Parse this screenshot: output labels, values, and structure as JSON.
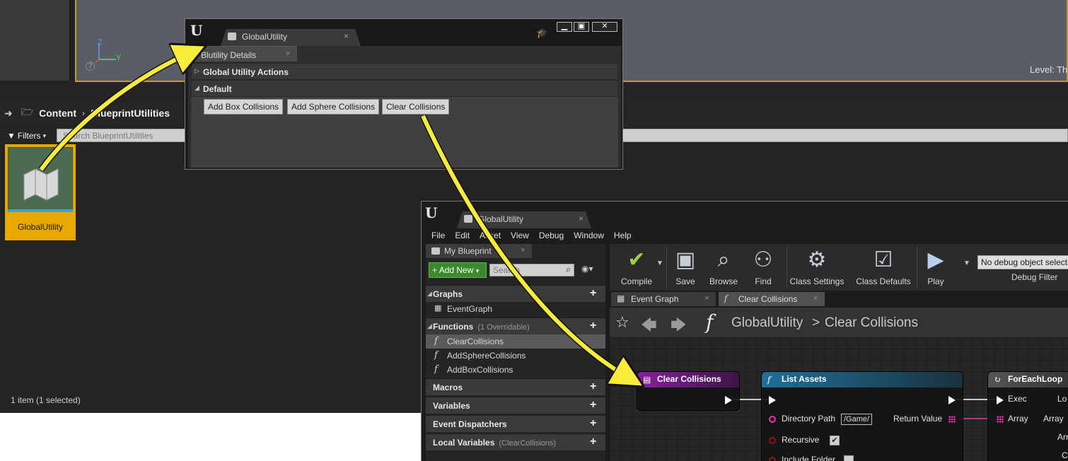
{
  "viewport": {
    "axis_z": "Z",
    "axis_y": "Y",
    "help": "?",
    "level_label": "Level:  Th"
  },
  "content_browser": {
    "path": [
      "Content",
      "BlueprintUtilities"
    ],
    "path_separator": "›",
    "filters_label": "Filters",
    "search_placeholder": "Search BlueprintUtilities",
    "asset_name": "GlobalUtility",
    "item_count": "1 item (1 selected)"
  },
  "utility_window": {
    "logo": "U",
    "tab_label": "GlobalUtility",
    "tab_close": "×",
    "subtab_label": "Blutility Details",
    "subtab_close": "×",
    "sections": [
      "Global Utility Actions",
      "Default"
    ],
    "buttons": [
      "Add Box Collisions",
      "Add Sphere Collisions",
      "Clear Collisions"
    ],
    "window_controls": {
      "minimize": "▁",
      "maximize": "▣",
      "close": "✕"
    }
  },
  "blueprint_editor": {
    "logo": "U",
    "tab_label": "GlobalUtility",
    "tab_close": "×",
    "menu": [
      "File",
      "Edit",
      "Asset",
      "View",
      "Debug",
      "Window",
      "Help"
    ],
    "my_blueprint": {
      "tab_label": "My Blueprint",
      "tab_close": "×",
      "add_new_label": "Add New",
      "search_placeholder": "Search",
      "categories": {
        "graphs": "Graphs",
        "functions": "Functions",
        "functions_sub": "(1 Overridable)",
        "macros": "Macros",
        "variables": "Variables",
        "dispatchers": "Event Dispatchers",
        "locals": "Local Variables",
        "locals_sub": "(ClearCollisions)"
      },
      "graph_items": [
        "EventGraph"
      ],
      "function_items": [
        "ClearCollisions",
        "AddSphereCollisions",
        "AddBoxCollisions"
      ],
      "plus": "+"
    },
    "toolbar": {
      "compile": "Compile",
      "save": "Save",
      "browse": "Browse",
      "find": "Find",
      "class_settings": "Class Settings",
      "class_defaults": "Class Defaults",
      "play": "Play",
      "debug_select": "No debug object selected",
      "debug_filter": "Debug Filter"
    },
    "graph_tabs": [
      {
        "label": "Event Graph",
        "close": "×"
      },
      {
        "label": "Clear Collisions",
        "close": "×"
      }
    ],
    "breadcrumb": {
      "blueprint": "GlobalUtility",
      "separator": ">",
      "function": "Clear Collisions"
    },
    "nodes": {
      "entry": {
        "title": "Clear Collisions"
      },
      "list_assets": {
        "title": "List Assets",
        "directory_path_label": "Directory Path",
        "directory_path_value": "/Game/",
        "return_value_label": "Return Value",
        "recursive_label": "Recursive",
        "include_folder_label": "Include Folder"
      },
      "for_each": {
        "title": "ForEachLoop",
        "exec_label": "Exec",
        "array_label": "Array",
        "out_loop": "Lo",
        "out_array": "Array",
        "out_index": "Arr",
        "out_completed": "C"
      }
    }
  },
  "colors": {
    "accent_yellow": "#f7ec3a",
    "selection_orange": "#e8a800",
    "entry_node": "#8a1fa0",
    "function_node": "#1f6f9a",
    "array_pin": "#f030b8"
  }
}
